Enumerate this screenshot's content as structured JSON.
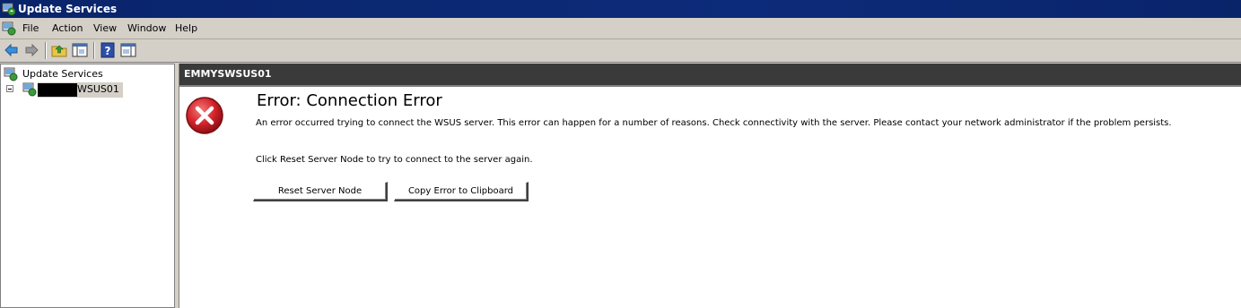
{
  "window": {
    "title": "Update Services",
    "icon": "update-services-icon"
  },
  "menu": {
    "items": [
      "File",
      "Action",
      "View",
      "Window",
      "Help"
    ]
  },
  "toolbar": {
    "buttons": [
      "back-arrow-icon",
      "forward-arrow-icon",
      "up-folder-icon",
      "show-hide-tree-icon",
      "help-icon",
      "action-pane-icon"
    ]
  },
  "tree": {
    "root_label": "Update Services",
    "server_label": "WSUS01"
  },
  "content": {
    "server_name": "EMMYSWSUS01",
    "error_title": "Error: Connection Error",
    "error_description": "An error occurred trying to connect the WSUS server. This error can happen for a number of reasons. Check connectivity with the server. Please contact your network administrator if the problem persists.",
    "reset_hint": "Click Reset Server Node to try to connect to the server again.",
    "reset_button": "Reset Server Node",
    "copy_button": "Copy Error to Clipboard"
  },
  "colors": {
    "titlebar": "#0a246a",
    "header": "#3a3a3a",
    "error_red": "#c8141e"
  }
}
